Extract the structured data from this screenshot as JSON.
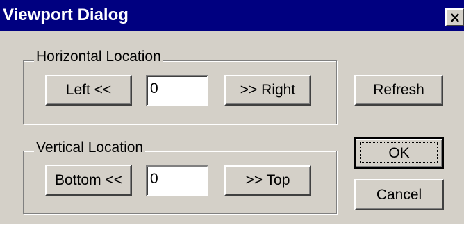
{
  "window": {
    "title": "Viewport Dialog",
    "close_icon": "close-icon"
  },
  "horizontal": {
    "group_label": "Horizontal Location",
    "left_label": "Left <<",
    "value": "0",
    "right_label": ">> Right"
  },
  "vertical": {
    "group_label": "Vertical Location",
    "bottom_label": "Bottom <<",
    "value": "0",
    "top_label": ">> Top"
  },
  "actions": {
    "refresh_label": "Refresh",
    "ok_label": "OK",
    "cancel_label": "Cancel"
  },
  "colors": {
    "title_bar": "#000080",
    "face": "#d4d0c8"
  }
}
